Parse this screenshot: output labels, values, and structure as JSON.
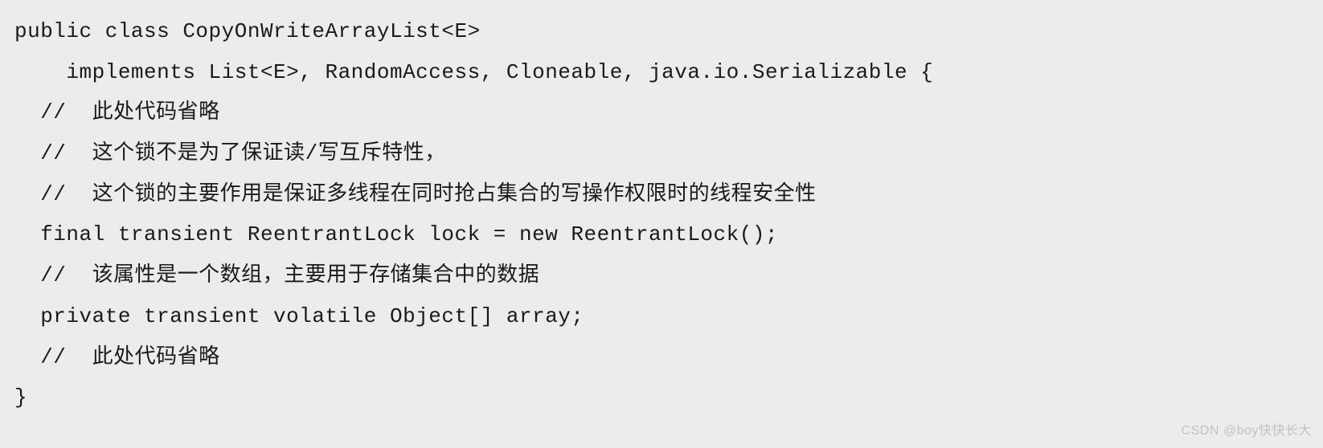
{
  "code": {
    "lines": [
      "public class CopyOnWriteArrayList<E>",
      "    implements List<E>, RandomAccess, Cloneable, java.io.Serializable {",
      "  //  此处代码省略",
      "  //  这个锁不是为了保证读/写互斥特性，",
      "  //  这个锁的主要作用是保证多线程在同时抢占集合的写操作权限时的线程安全性",
      "  final transient ReentrantLock lock = new ReentrantLock();",
      "  //  该属性是一个数组，主要用于存储集合中的数据",
      "  private transient volatile Object[] array;",
      "  //  此处代码省略",
      "}"
    ]
  },
  "watermark": "CSDN @boy快快长大"
}
